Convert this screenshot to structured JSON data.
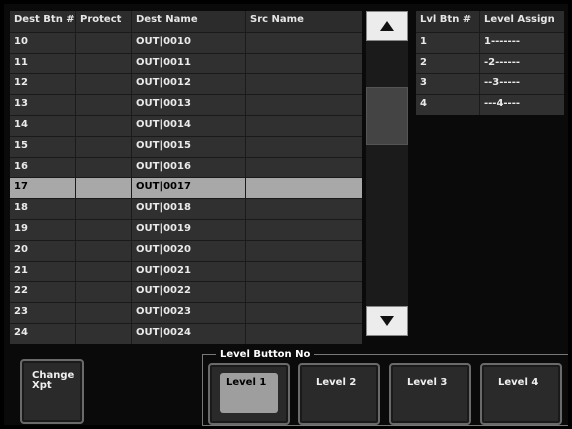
{
  "table": {
    "headers": [
      "Dest Btn #",
      "Protect",
      "Dest Name",
      "Src Name"
    ],
    "rows": [
      {
        "btn": "10",
        "protect": "",
        "dest": "OUT|0010",
        "src": ""
      },
      {
        "btn": "11",
        "protect": "",
        "dest": "OUT|0011",
        "src": ""
      },
      {
        "btn": "12",
        "protect": "",
        "dest": "OUT|0012",
        "src": ""
      },
      {
        "btn": "13",
        "protect": "",
        "dest": "OUT|0013",
        "src": ""
      },
      {
        "btn": "14",
        "protect": "",
        "dest": "OUT|0014",
        "src": ""
      },
      {
        "btn": "15",
        "protect": "",
        "dest": "OUT|0015",
        "src": ""
      },
      {
        "btn": "16",
        "protect": "",
        "dest": "OUT|0016",
        "src": ""
      },
      {
        "btn": "17",
        "protect": "",
        "dest": "OUT|0017",
        "src": "",
        "selected": true
      },
      {
        "btn": "18",
        "protect": "",
        "dest": "OUT|0018",
        "src": ""
      },
      {
        "btn": "19",
        "protect": "",
        "dest": "OUT|0019",
        "src": ""
      },
      {
        "btn": "20",
        "protect": "",
        "dest": "OUT|0020",
        "src": ""
      },
      {
        "btn": "21",
        "protect": "",
        "dest": "OUT|0021",
        "src": ""
      },
      {
        "btn": "22",
        "protect": "",
        "dest": "OUT|0022",
        "src": ""
      },
      {
        "btn": "23",
        "protect": "",
        "dest": "OUT|0023",
        "src": ""
      },
      {
        "btn": "24",
        "protect": "",
        "dest": "OUT|0024",
        "src": ""
      }
    ]
  },
  "scroll": {
    "up_icon": "arrow-up-icon",
    "down_icon": "arrow-down-icon"
  },
  "levels": {
    "headers": [
      "Lvl Btn #",
      "Level Assign"
    ],
    "rows": [
      {
        "btn": "1",
        "assign": "1-------"
      },
      {
        "btn": "2",
        "assign": "-2------"
      },
      {
        "btn": "3",
        "assign": "--3-----"
      },
      {
        "btn": "4",
        "assign": "---4----"
      }
    ]
  },
  "bottom": {
    "group_title": "Level Button No",
    "change_xpt_line1": "Change",
    "change_xpt_line2": "Xpt",
    "level_buttons": [
      "Level 1",
      "Level 2",
      "Level 3",
      "Level 4"
    ],
    "active_level": "Level 1"
  },
  "colors": {
    "selected_row": "#a8a8a8",
    "row_bg": "#303030",
    "scroll_button": "#ececec"
  }
}
